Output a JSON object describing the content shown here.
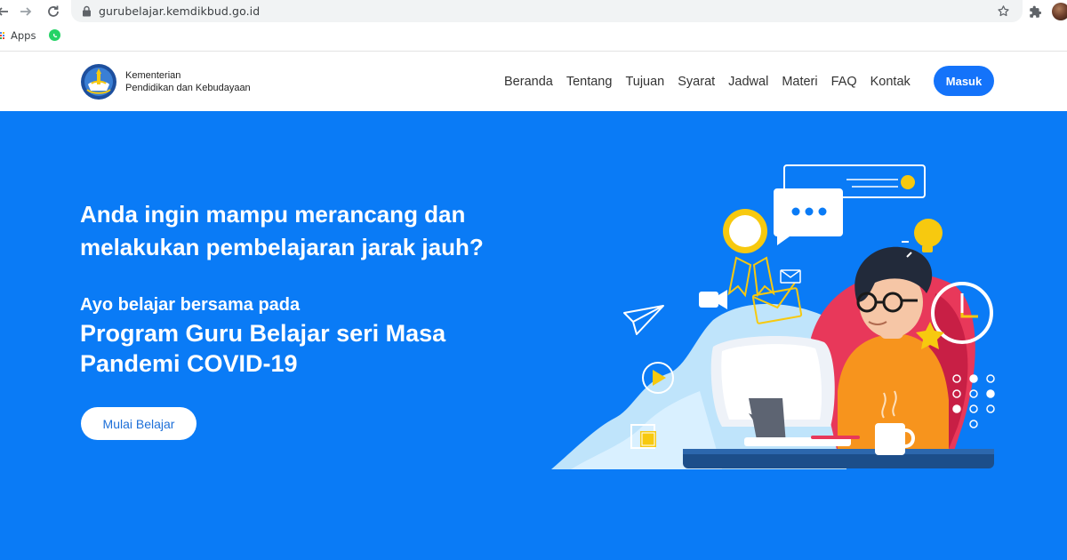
{
  "browser": {
    "url": "gurubelajar.kemdikbud.go.id",
    "bookmarks": [
      {
        "label": "Apps",
        "icon": "apps-grid-icon"
      },
      {
        "label": "",
        "icon": "whatsapp-icon"
      }
    ]
  },
  "header": {
    "brand_line1": "Kementerian",
    "brand_line2": "Pendidikan dan Kebudayaan",
    "nav": [
      "Beranda",
      "Tentang",
      "Tujuan",
      "Syarat",
      "Jadwal",
      "Materi",
      "FAQ",
      "Kontak"
    ],
    "login_label": "Masuk"
  },
  "hero": {
    "headline": "Anda ingin mampu merancang dan melakukan pembelajaran jarak jauh?",
    "subline": "Ayo belajar bersama pada",
    "program": "Program Guru Belajar seri Masa Pandemi COVID-19",
    "cta_label": "Mulai Belajar"
  },
  "colors": {
    "hero_bg": "#0a7bf6",
    "login_btn": "#1473fa",
    "accent_yellow": "#f7c90f",
    "chair_red": "#e8385a",
    "shirt_orange": "#f7941d"
  }
}
